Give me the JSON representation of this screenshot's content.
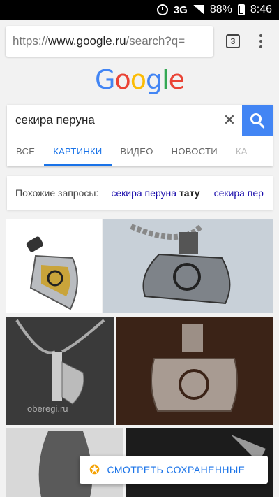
{
  "status_bar": {
    "network": "3G",
    "battery": "88%",
    "time": "8:46"
  },
  "browser": {
    "url_prefix": "https://",
    "url_host": "www.google.ru",
    "url_path": "/search?q=",
    "tab_count": "3"
  },
  "logo": {
    "letters": [
      "G",
      "o",
      "o",
      "g",
      "l",
      "e"
    ],
    "colors": [
      "#4285F4",
      "#EA4335",
      "#FBBC05",
      "#4285F4",
      "#34A853",
      "#EA4335"
    ]
  },
  "search": {
    "query": "секира перуна",
    "clear_symbol": "✕",
    "tabs": [
      {
        "label": "ВСЕ"
      },
      {
        "label": "КАРТИНКИ"
      },
      {
        "label": "ВИДЕО"
      },
      {
        "label": "НОВОСТИ"
      },
      {
        "label": "КА"
      }
    ]
  },
  "related": {
    "label": "Похожие запросы:",
    "items": [
      {
        "text": "секира перуна",
        "bold": "тату"
      },
      {
        "text": "секира пер",
        "bold": ""
      }
    ]
  },
  "images": {
    "watermark": "oberegi.ru"
  },
  "saved_button": {
    "label": "СМОТРЕТЬ СОХРАНЕННЫЕ",
    "icon": "star-icon"
  },
  "colors": {
    "accent": "#1A73E8",
    "search_button": "#4285F4",
    "star": "#F5A100"
  }
}
